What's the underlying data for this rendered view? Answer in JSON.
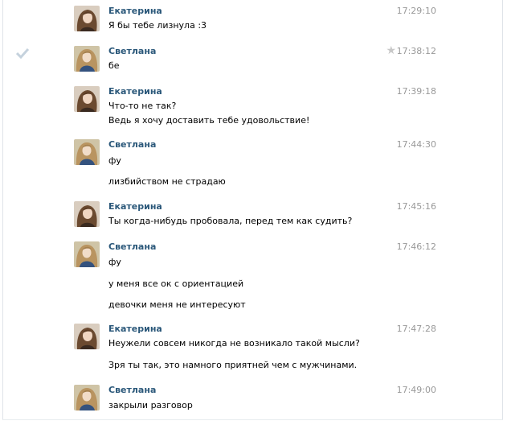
{
  "messages": [
    {
      "author": "Екатерина",
      "avatar": "avatar-ekaterina",
      "time": "17:29:10",
      "lines": [
        "Я бы тебе лизнула :3"
      ]
    },
    {
      "author": "Светлана",
      "avatar": "avatar-svetlana",
      "time": "17:38:12",
      "lines": [
        "бе"
      ],
      "selected": true,
      "starred": true
    },
    {
      "author": "Екатерина",
      "avatar": "avatar-ekaterina",
      "time": "17:39:18",
      "lines": [
        "Что-то не так?",
        "Ведь я хочу доставить тебе удовольствие!"
      ]
    },
    {
      "author": "Светлана",
      "avatar": "avatar-svetlana",
      "time": "17:44:30",
      "lines": [
        "фу",
        "лизбийством не страдаю"
      ]
    },
    {
      "author": "Екатерина",
      "avatar": "avatar-ekaterina",
      "time": "17:45:16",
      "lines": [
        "Ты когда-нибудь пробовала, перед тем как судить?"
      ]
    },
    {
      "author": "Светлана",
      "avatar": "avatar-svetlana",
      "time": "17:46:12",
      "lines": [
        "фу",
        "у меня все ок с ориентацией",
        "девочки меня не интересуют"
      ]
    },
    {
      "author": "Екатерина",
      "avatar": "avatar-ekaterina",
      "time": "17:47:28",
      "lines": [
        "Неужели совсем никогда не возникало такой мысли?",
        "Зря ты так, это намного приятней чем с мужчинами."
      ]
    },
    {
      "author": "Светлана",
      "avatar": "avatar-svetlana",
      "time": "17:49:00",
      "lines": [
        "закрыли разговор"
      ]
    }
  ],
  "icons": {
    "select": "checkmark-icon",
    "important": "star-icon"
  },
  "colors": {
    "author": "#2b587a",
    "time": "#999999",
    "text": "#000000",
    "check": "#c5d2dd"
  }
}
